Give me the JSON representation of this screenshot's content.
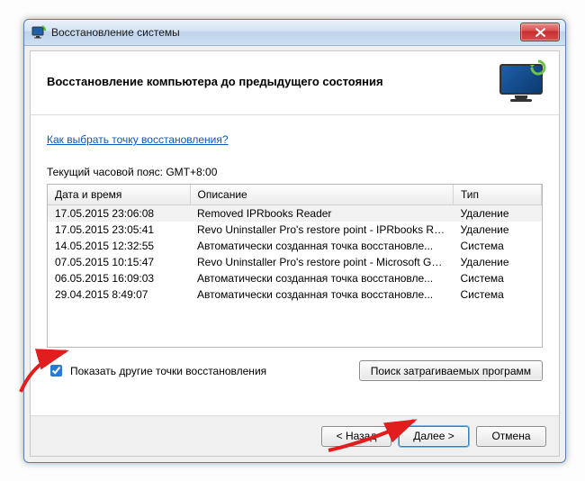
{
  "window": {
    "title": "Восстановление системы"
  },
  "header": {
    "title": "Восстановление компьютера до предыдущего состояния"
  },
  "link_text": "Как выбрать точку восстановления?",
  "timezone_label": "Текущий часовой пояс: GMT+8:00",
  "columns": {
    "c1": "Дата и время",
    "c2": "Описание",
    "c3": "Тип"
  },
  "rows": [
    {
      "dt": "17.05.2015 23:06:08",
      "desc": "Removed IPRbooks Reader",
      "type": "Удаление"
    },
    {
      "dt": "17.05.2015 23:05:41",
      "desc": "Revo Uninstaller Pro's restore point - IPRbooks Re...",
      "type": "Удаление"
    },
    {
      "dt": "14.05.2015 12:32:55",
      "desc": "Автоматически созданная точка восстановле...",
      "type": "Система"
    },
    {
      "dt": "07.05.2015 10:15:47",
      "desc": "Revo Uninstaller Pro's restore point - Microsoft Ga...",
      "type": "Удаление"
    },
    {
      "dt": "06.05.2015 16:09:03",
      "desc": "Автоматически созданная точка восстановле...",
      "type": "Система"
    },
    {
      "dt": "29.04.2015 8:49:07",
      "desc": "Автоматически созданная точка восстановле...",
      "type": "Система"
    }
  ],
  "checkbox_label": "Показать другие точки восстановления",
  "affected_button": "Поиск затрагиваемых программ",
  "footer": {
    "back": "< Назад",
    "next": "Далее >",
    "cancel": "Отмена"
  }
}
